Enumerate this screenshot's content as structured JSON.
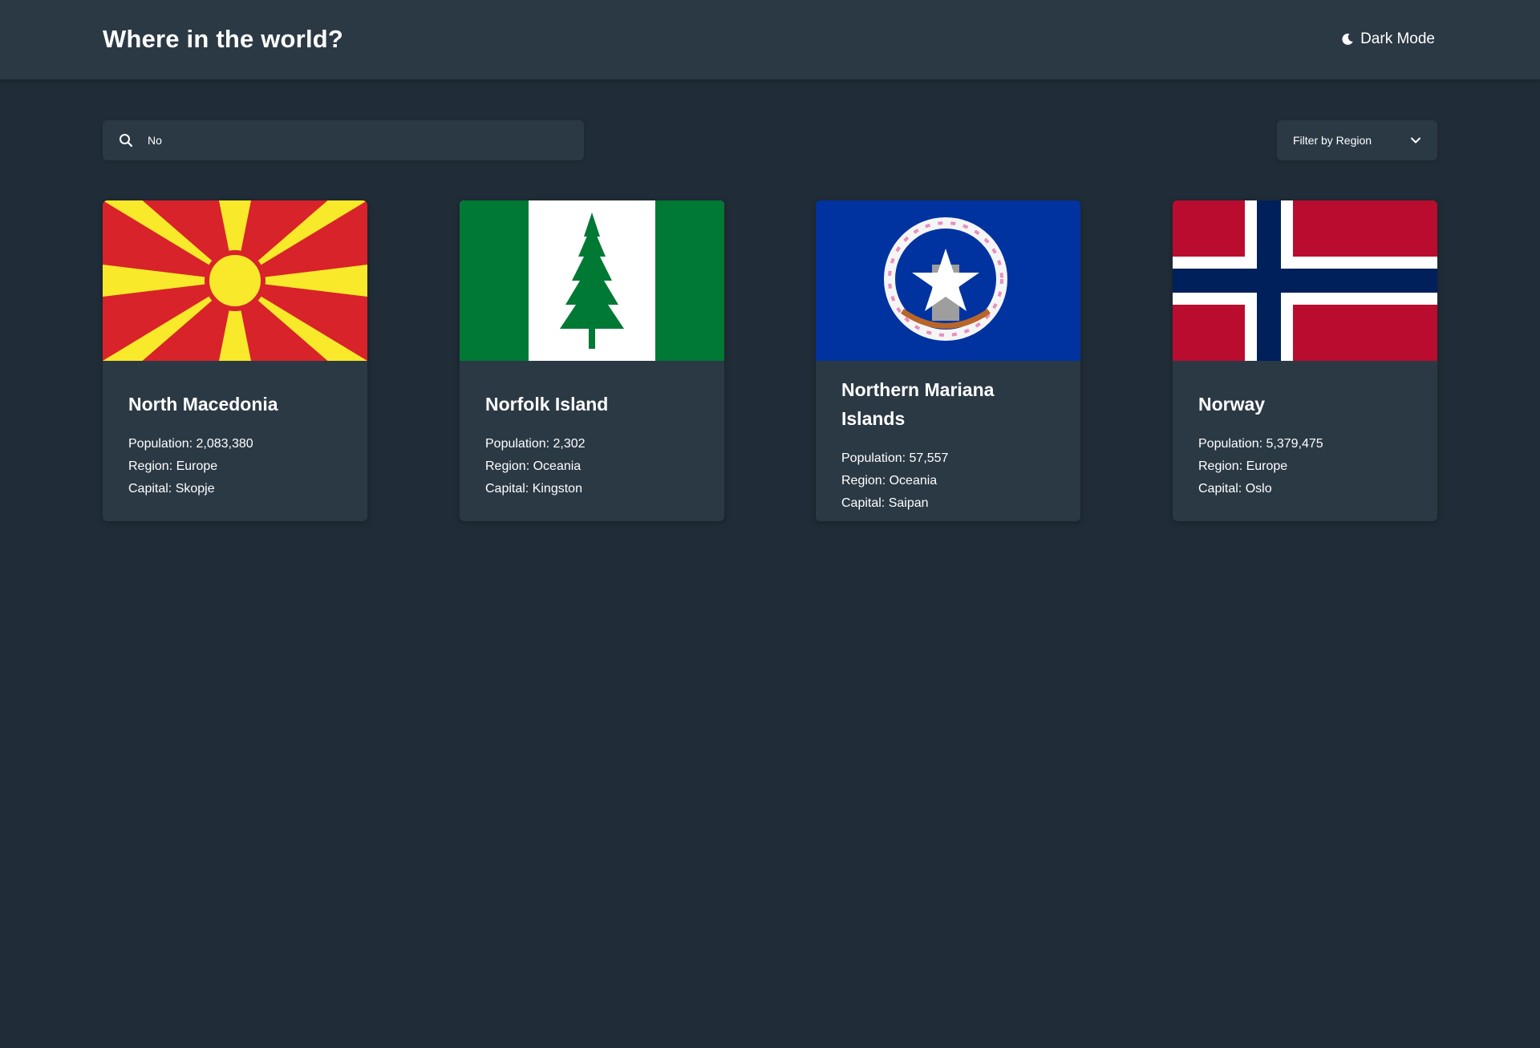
{
  "header": {
    "title": "Where in the world?",
    "theme_toggle_label": "Dark Mode",
    "theme_toggle_icon": "moon-icon"
  },
  "search": {
    "value": "No",
    "placeholder": "Search for a country...",
    "icon": "search-icon"
  },
  "filter": {
    "label": "Filter by Region",
    "icon": "chevron-down-icon"
  },
  "colors": {
    "background": "#202c37",
    "surface": "#2b3945",
    "text": "#ffffff"
  },
  "labels": {
    "population": "Population:",
    "region": "Region:",
    "capital": "Capital:"
  },
  "countries": [
    {
      "name": "North Macedonia",
      "population": "2,083,380",
      "region": "Europe",
      "capital": "Skopje",
      "flag": "north-macedonia-flag"
    },
    {
      "name": "Norfolk Island",
      "population": "2,302",
      "region": "Oceania",
      "capital": "Kingston",
      "flag": "norfolk-island-flag"
    },
    {
      "name": "Northern Mariana Islands",
      "population": "57,557",
      "region": "Oceania",
      "capital": "Saipan",
      "flag": "northern-mariana-islands-flag"
    },
    {
      "name": "Norway",
      "population": "5,379,475",
      "region": "Europe",
      "capital": "Oslo",
      "flag": "norway-flag"
    }
  ]
}
